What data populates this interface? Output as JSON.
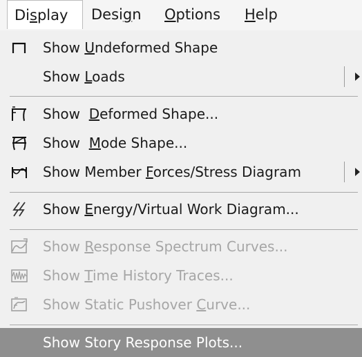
{
  "menubar": {
    "items": [
      {
        "pre": "Di",
        "ul": "s",
        "post": "play"
      },
      {
        "pre": "Desi",
        "ul": "g",
        "post": "n"
      },
      {
        "pre": "",
        "ul": "O",
        "post": "ptions"
      },
      {
        "pre": "",
        "ul": "H",
        "post": "elp"
      }
    ],
    "active": "Display"
  },
  "menu": {
    "items": [
      {
        "pre": "Show ",
        "ul": "U",
        "post": "ndeformed Shape",
        "icon": "undeformed-shape-icon",
        "disabled": false,
        "submenu": false
      },
      {
        "pre": "Show ",
        "ul": "L",
        "post": "oads",
        "icon": "",
        "disabled": false,
        "submenu": true
      },
      {
        "pre": "Show  ",
        "ul": "D",
        "post": "eformed Shape...",
        "icon": "deformed-shape-icon",
        "disabled": false,
        "submenu": false
      },
      {
        "pre": "Show  ",
        "ul": "M",
        "post": "ode Shape...",
        "icon": "mode-shape-icon",
        "disabled": false,
        "submenu": false
      },
      {
        "pre": "Show Member ",
        "ul": "F",
        "post": "orces/Stress Diagram",
        "icon": "member-forces-icon",
        "disabled": false,
        "submenu": true
      },
      {
        "pre": "Show ",
        "ul": "E",
        "post": "nergy/Virtual Work Diagram...",
        "icon": "energy-icon",
        "disabled": false,
        "submenu": false
      },
      {
        "pre": "Show ",
        "ul": "R",
        "post": "esponse Spectrum Curves...",
        "icon": "response-spectrum-icon",
        "disabled": true,
        "submenu": false
      },
      {
        "pre": "Show ",
        "ul": "T",
        "post": "ime History Traces...",
        "icon": "time-history-icon",
        "disabled": true,
        "submenu": false
      },
      {
        "pre": "Show Static Pushover ",
        "ul": "C",
        "post": "urve...",
        "icon": "pushover-curve-icon",
        "disabled": true,
        "submenu": false
      },
      {
        "pre": "Show Story Response Plots...",
        "ul": "",
        "post": "",
        "icon": "",
        "disabled": false,
        "submenu": false,
        "highlighted": true
      }
    ]
  },
  "colors": {
    "highlight": "#8f8f8f",
    "disabled_text": "#a6a6a6",
    "menu_bg": "#f0f0f0"
  }
}
